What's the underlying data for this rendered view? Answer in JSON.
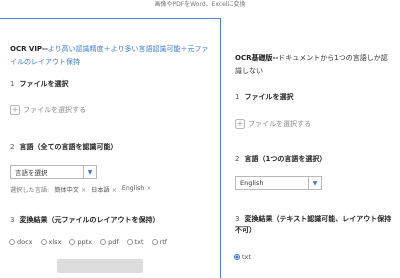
{
  "header": {
    "subtitle": "画像やPDFをWord、Excelに変換"
  },
  "vip": {
    "title_strong": "OCR VIP--",
    "title_rest": "より高い認識精度＋より多い言語認識可能＋元ファイルのレイアウト保持",
    "step1": {
      "num": "1",
      "label": "ファイルを選択"
    },
    "file_button": "ファイルを選択する",
    "step2": {
      "num": "2",
      "label": "言語（全ての言語を認識可能）"
    },
    "language_select": "言語を選択",
    "selected_prefix": "選択した言語:",
    "selected_languages": [
      "簡体中文",
      "日本語",
      "English"
    ],
    "step3": {
      "num": "3",
      "label": "変換結果（元ファイルのレイアウトを保持）"
    },
    "formats": [
      "docx",
      "xlsx",
      "pptx",
      "pdf",
      "txt",
      "rtf"
    ]
  },
  "basic": {
    "title_strong": "OCR基礎版--",
    "title_rest": "ドキュメントから1つの言語しか認識しない",
    "step1": {
      "num": "1",
      "label": "ファイルを選択"
    },
    "file_button": "ファイルを選択する",
    "step2": {
      "num": "2",
      "label": "言語（1つの言語を選択）"
    },
    "language_select": "English",
    "step3": {
      "num": "3",
      "label": "変換結果（テキスト認識可能、レイアウト保持不可）"
    },
    "formats": [
      "txt"
    ]
  },
  "colors": {
    "accent": "#3b79d6",
    "panel_border": "#4f7fd6"
  }
}
